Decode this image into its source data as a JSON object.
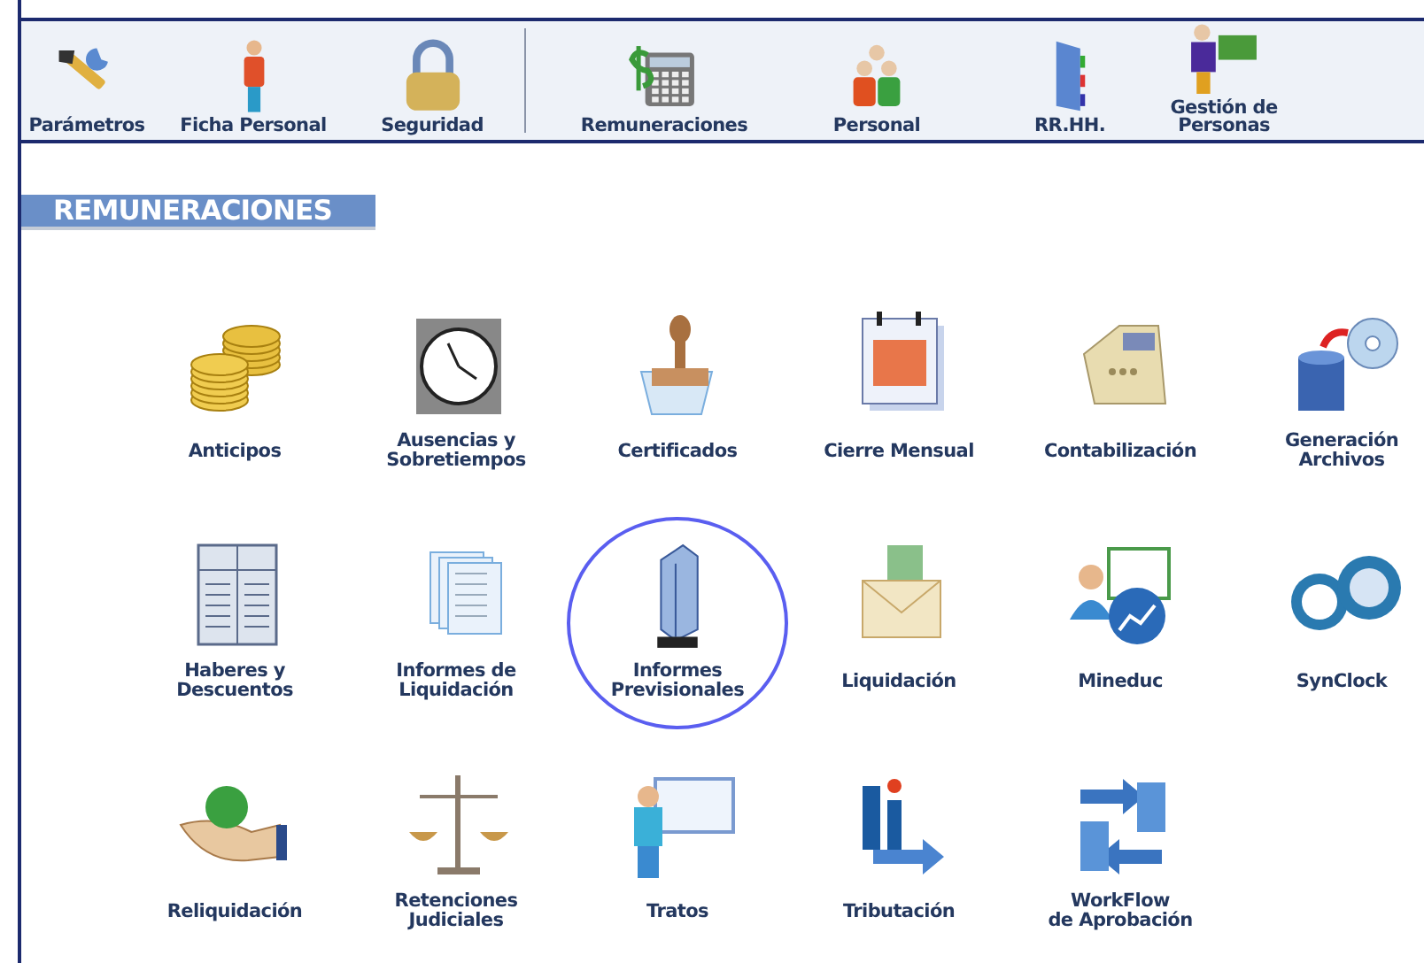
{
  "toolbar": {
    "groups": [
      {
        "items": [
          {
            "label": "Parámetros"
          },
          {
            "label": "Ficha Personal"
          },
          {
            "label": "Seguridad"
          }
        ]
      },
      {
        "items": [
          {
            "label": "Remuneraciones"
          },
          {
            "label": "Personal"
          },
          {
            "label": "RR.HH."
          },
          {
            "label": "Gestión de\nPersonas"
          }
        ]
      }
    ]
  },
  "section": {
    "title": "REMUNERACIONES"
  },
  "modules": [
    {
      "label": "Anticipos",
      "selected": false
    },
    {
      "label": "Ausencias y\nSobretiempos",
      "selected": false
    },
    {
      "label": "Certificados",
      "selected": false
    },
    {
      "label": "Cierre Mensual",
      "selected": false
    },
    {
      "label": "Contabilización",
      "selected": false
    },
    {
      "label": "Generación\nArchivos",
      "selected": false
    },
    {
      "label": "Haberes y\nDescuentos",
      "selected": false
    },
    {
      "label": "Informes de\nLiquidación",
      "selected": false
    },
    {
      "label": "Informes\nPrevisionales",
      "selected": true
    },
    {
      "label": "Liquidación",
      "selected": false
    },
    {
      "label": "Mineduc",
      "selected": false
    },
    {
      "label": "SynClock",
      "selected": false
    },
    {
      "label": "Reliquidación",
      "selected": false
    },
    {
      "label": "Retenciones\nJudiciales",
      "selected": false
    },
    {
      "label": "Tratos",
      "selected": false
    },
    {
      "label": "Tributación",
      "selected": false
    },
    {
      "label": "WorkFlow\nde Aprobación",
      "selected": false
    }
  ]
}
